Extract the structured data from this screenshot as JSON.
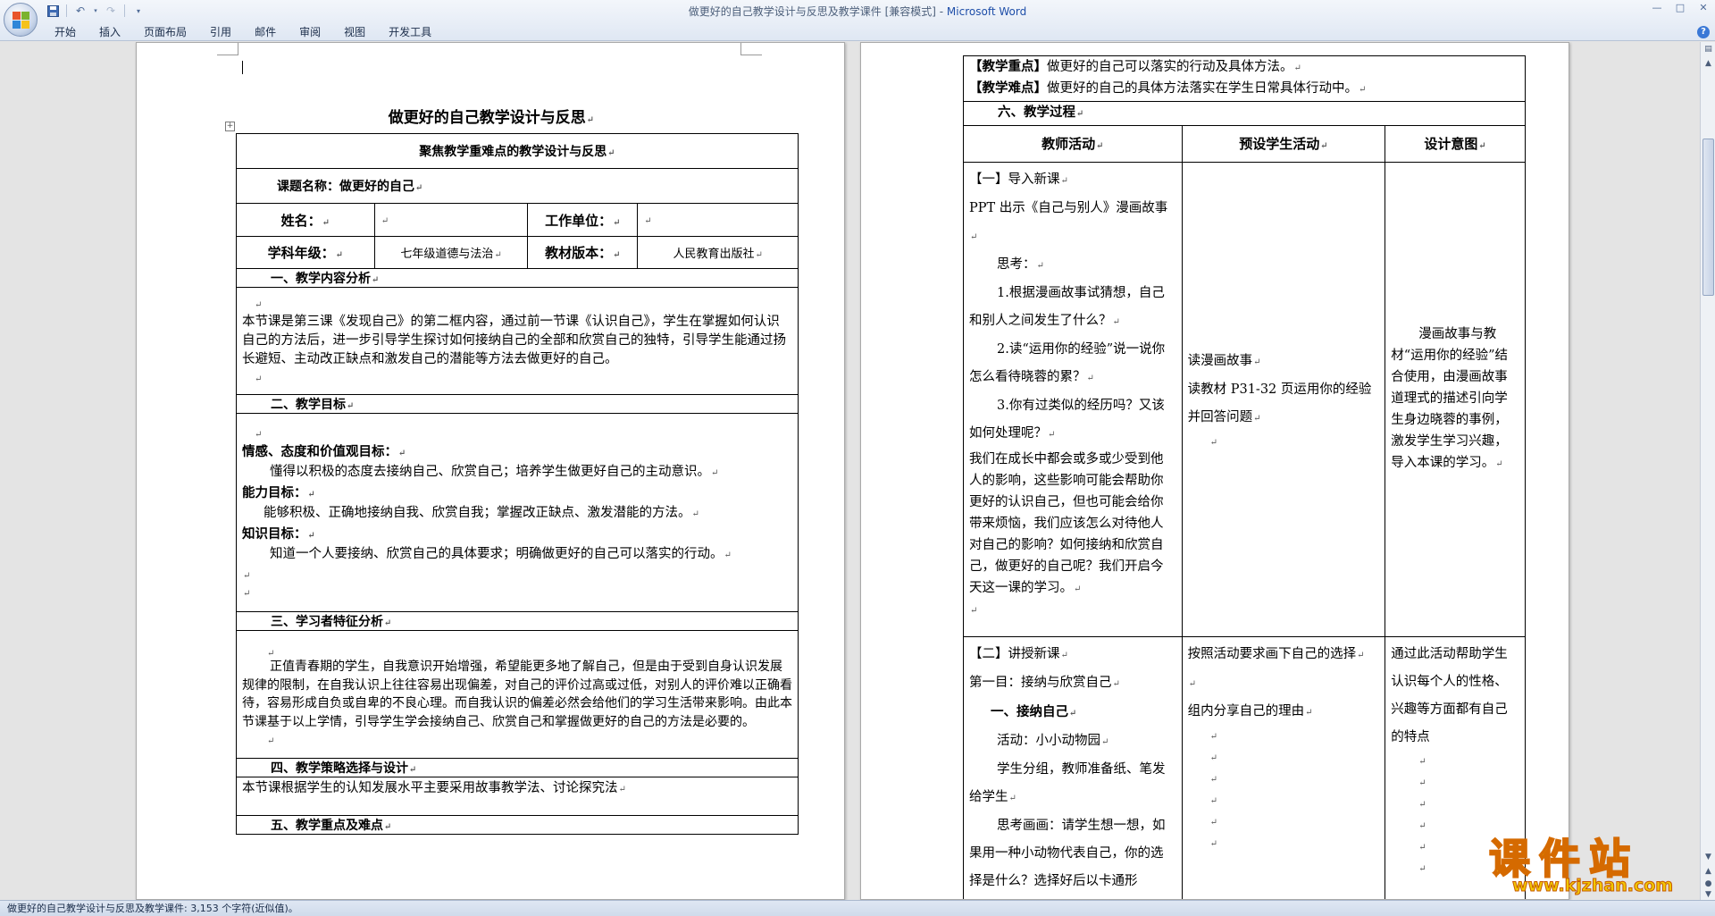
{
  "window": {
    "title_doc": "做更好的自己教学设计与反思及教学课件 [兼容模式] - ",
    "title_app": "Microsoft Word",
    "controls": [
      "—",
      "□",
      "✕"
    ]
  },
  "quick_access": {
    "save_icon": "save-icon",
    "undo_icon": "undo-icon",
    "redo_icon": "redo-icon",
    "customize_icon": "dropdown-icon"
  },
  "ribbon": {
    "tabs": [
      "开始",
      "插入",
      "页面布局",
      "引用",
      "邮件",
      "审阅",
      "视图",
      "开发工具"
    ],
    "help": "?"
  },
  "page1": {
    "title": "做更好的自己教学设计与反思",
    "table_header": "聚焦教学重难点的教学设计与反思",
    "course_name": "课题名称：做更好的自己",
    "name_label": "姓名：",
    "unit_label": "工作单位：",
    "grade_label": "学科年级：",
    "grade_value": "七年级道德与法治",
    "edition_label": "教材版本：",
    "edition_value": "人民教育出版社",
    "sec1": "一、教学内容分析",
    "sec1_body": "本节课是第三课《发现自己》的第二框内容，通过前一节课《认识自己》，学生在掌握如何认识自己的方法后，进一步引导学生探讨如何接纳自己的全部和欣赏自己的独特，引导学生能通过扬长避短、主动改正缺点和激发自己的潜能等方法去做更好的自己。",
    "sec2": "二、教学目标",
    "goal1_label": "情感、态度和价值观目标：",
    "goal1_text": "懂得以积极的态度去接纳自己、欣赏自己；培养学生做更好自己的主动意识。",
    "goal2_label": "能力目标：",
    "goal2_text": "能够积极、正确地接纳自我、欣赏自我；掌握改正缺点、激发潜能的方法。",
    "goal3_label": "知识目标：",
    "goal3_text": "知道一个人要接纳、欣赏自己的具体要求；明确做更好的自己可以落实的行动。",
    "sec3": "三、学习者特征分析",
    "sec3_body": "正值青春期的学生，自我意识开始增强，希望能更多地了解自己，但是由于受到自身认识发展规律的限制，在自我认识上往往容易出现偏差，对自己的评价过高或过低，对别人的评价难以正确看待，容易形成自负或自卑的不良心理。而自我认识的偏差必然会给他们的学习生活带来影响。由此本节课基于以上学情，引导学生学会接纳自己、欣赏自己和掌握做更好的自己的方法是必要的。",
    "sec4": "四、教学策略选择与设计",
    "sec4_body": "本节课根据学生的认知发展水平主要采用故事教学法、讨论探究法",
    "sec5": "五、教学重点及难点"
  },
  "page2": {
    "key_label": "【教学重点】",
    "key_text": "做更好的自己可以落实的行动及具体方法。",
    "diff_label": "【教学难点】",
    "diff_text": "做更好的自己的具体方法落实在学生日常具体行动中。",
    "sec6": "六、教学过程",
    "col_teacher": "教师活动",
    "col_student": "预设学生活动",
    "col_intent": "设计意图",
    "r1_teacher": [
      "【一】导入新课",
      "PPT 出示《自己与别人》漫画故事",
      "思考：",
      "1.根据漫画故事试猜想，自己和别人之间发生了什么？",
      "2.读“运用你的经验”说一说你怎么看待晓蓉的累？",
      "3.你有过类似的经历吗？又该如何处理呢？",
      "我们在成长中都会或多或少受到他人的影响，这些影响可能会帮助你更好的认识自己，但也可能会给你带来烦恼，我们应该怎么对待他人对自己的影响？如何接纳和欣赏自己，做更好的自己呢？我们开启今天这一课的学习。"
    ],
    "r1_student": [
      "读漫画故事",
      "读教材 P31-32 页运用你的经验并回答问题"
    ],
    "r1_intent": "漫画故事与教材“运用你的经验”结合使用，由漫画故事道理式的描述引向学生身边晓蓉的事例，激发学生学习兴趣，导入本课的学习。",
    "r2_teacher": [
      "【二】讲授新课",
      "第一目：接纳与欣赏自己",
      "一、接纳自己",
      "活动：小小动物园",
      "学生分组，教师准备纸、笔发给学生",
      "思考画画：请学生想一想，如果用一种小动物代表自己，你的选择是什么？选择好后以卡通形"
    ],
    "r2_student": [
      "按照活动要求画下自己的选择",
      "组内分享自己的理由"
    ],
    "r2_intent": "通过此活动帮助学生认识每个人的性格、兴趣等方面都有自己的特点"
  },
  "statusbar": {
    "text": "做更好的自己教学设计与反思及教学课件: 3,153 个字符(近似值)。"
  },
  "watermark": {
    "big": "课件站",
    "small": "www.kjzhan.com"
  },
  "colors": {
    "accent": "#1e4ea8",
    "watermark_fill": "#f5d400",
    "watermark_stroke": "#d56a00"
  }
}
